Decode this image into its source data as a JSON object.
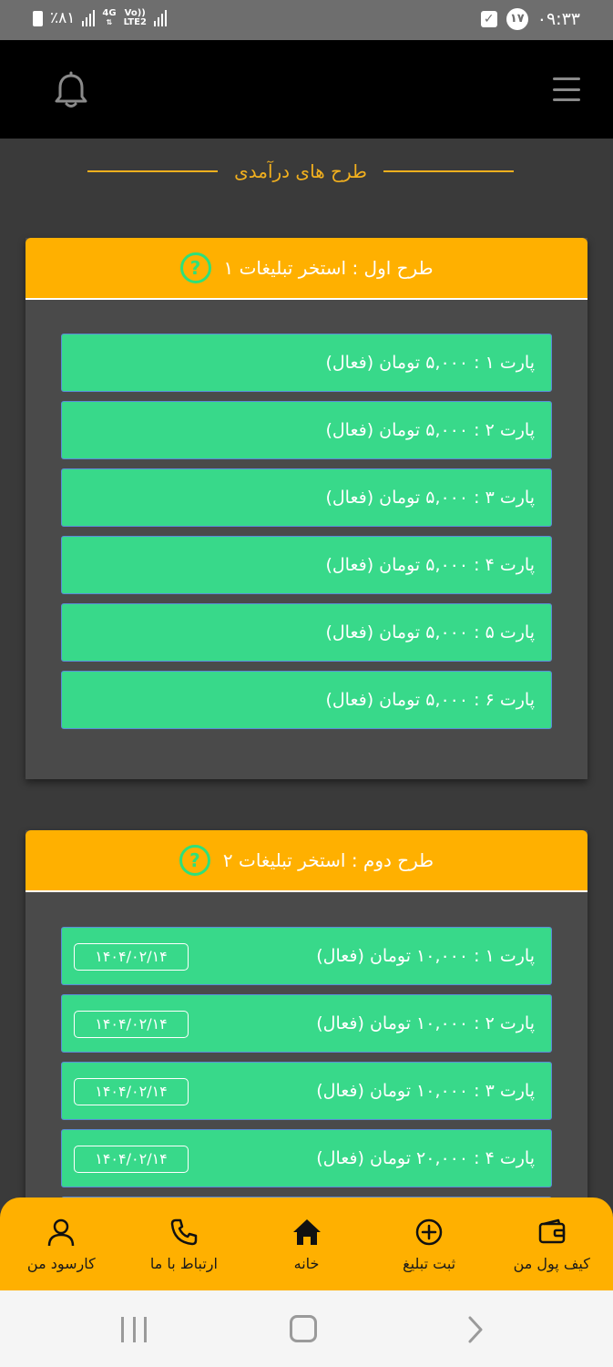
{
  "status_bar": {
    "battery": "٪۸۱",
    "network_top": "4G",
    "network_volte": "Vo))",
    "network_bottom": "LTE2",
    "notification_count": "۱۷",
    "time": "۰۹:۳۳"
  },
  "header": {
    "bell_icon": "bell-icon",
    "menu_icon": "hamburger-icon"
  },
  "section_title": "طرح های درآمدی",
  "plans": [
    {
      "title": "طرح اول : استخر تبلیغات ۱",
      "help": "?",
      "parts": [
        {
          "label": "پارت ۱ : ۵,۰۰۰ تومان (فعال)"
        },
        {
          "label": "پارت ۲ : ۵,۰۰۰ تومان (فعال)"
        },
        {
          "label": "پارت ۳ : ۵,۰۰۰ تومان (فعال)"
        },
        {
          "label": "پارت ۴ : ۵,۰۰۰ تومان (فعال)"
        },
        {
          "label": "پارت ۵ : ۵,۰۰۰ تومان (فعال)"
        },
        {
          "label": "پارت ۶ : ۵,۰۰۰ تومان (فعال)"
        }
      ]
    },
    {
      "title": "طرح دوم : استخر تبلیغات ۲",
      "help": "?",
      "parts": [
        {
          "label": "پارت ۱ : ۱۰,۰۰۰ تومان (فعال)",
          "date": "۱۴۰۴/۰۲/۱۴"
        },
        {
          "label": "پارت ۲ : ۱۰,۰۰۰ تومان (فعال)",
          "date": "۱۴۰۴/۰۲/۱۴"
        },
        {
          "label": "پارت ۳ : ۱۰,۰۰۰ تومان (فعال)",
          "date": "۱۴۰۴/۰۲/۱۴"
        },
        {
          "label": "پارت ۴ : ۲۰,۰۰۰ تومان (فعال)",
          "date": "۱۴۰۴/۰۲/۱۴"
        }
      ]
    }
  ],
  "bottom_nav": [
    {
      "label": "کیف پول من",
      "icon": "wallet-icon"
    },
    {
      "label": "ثبت تبلیغ",
      "icon": "plus-circle-icon"
    },
    {
      "label": "خانه",
      "icon": "home-icon"
    },
    {
      "label": "ارتباط با ما",
      "icon": "phone-icon"
    },
    {
      "label": "کارسود من",
      "icon": "user-icon"
    }
  ],
  "colors": {
    "accent": "#ffb000",
    "part_green": "#38d98a",
    "title_gold": "#f2b01e",
    "background": "#3a3a3a"
  }
}
